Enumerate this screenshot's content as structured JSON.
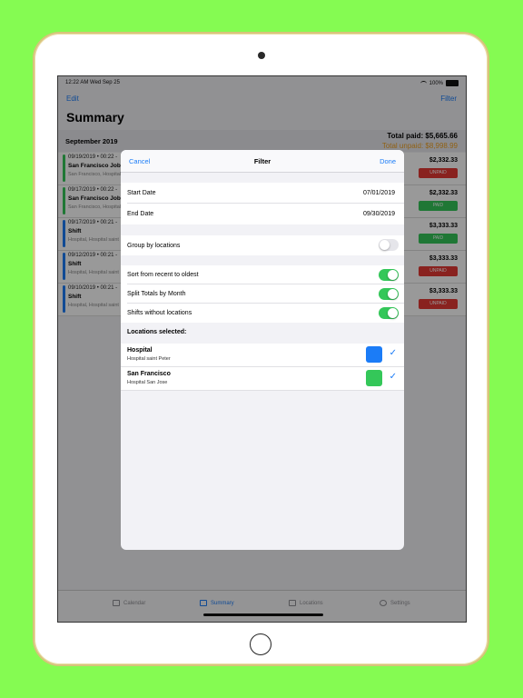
{
  "status": {
    "time": "12:22 AM  Wed Sep 25",
    "battery": "100%"
  },
  "nav": {
    "edit": "Edit",
    "filter": "Filter"
  },
  "title": "Summary",
  "section": {
    "month": "September 2019",
    "total_paid": "Total paid: $5,665.66",
    "total_unpaid": "Total unpaid: $8,998.99"
  },
  "colors": {
    "green": "#34c759",
    "blue": "#1b7cf7",
    "red": "#e53935",
    "orange": "#f0a224"
  },
  "rows": [
    {
      "date": "09/19/2019 • 00:22 -",
      "name": "San Francisco Job",
      "sub": "San Francisco, Hospital",
      "amount": "$2,332.33",
      "status": "UNPAID",
      "bar_color": "#34c759"
    },
    {
      "date": "09/17/2019 • 00:22 -",
      "name": "San Francisco Job",
      "sub": "San Francisco, Hospital",
      "amount": "$2,332.33",
      "status": "PAID",
      "bar_color": "#34c759"
    },
    {
      "date": "09/17/2019 • 00:21 -",
      "name": "Shift",
      "sub": "Hospital, Hospital saint",
      "amount": "$3,333.33",
      "status": "PAID",
      "bar_color": "#1b7cf7"
    },
    {
      "date": "09/12/2019 • 00:21 -",
      "name": "Shift",
      "sub": "Hospital, Hospital saint",
      "amount": "$3,333.33",
      "status": "UNPAID",
      "bar_color": "#1b7cf7"
    },
    {
      "date": "09/10/2019 • 00:21 -",
      "name": "Shift",
      "sub": "Hospital, Hospital saint",
      "amount": "$3,333.33",
      "status": "UNPAID",
      "bar_color": "#1b7cf7"
    }
  ],
  "tabs": [
    "Calendar",
    "Summary",
    "Locations",
    "Settings"
  ],
  "modal": {
    "cancel": "Cancel",
    "title": "Filter",
    "done": "Done",
    "start_label": "Start Date",
    "start_value": "07/01/2019",
    "end_label": "End Date",
    "end_value": "09/30/2019",
    "group_label": "Group by locations",
    "sort_label": "Sort from recent to oldest",
    "split_label": "Split Totals by Month",
    "shifts_label": "Shifts without locations",
    "locations_header": "Locations selected:",
    "locations": [
      {
        "name": "Hospital",
        "sub": "Hospital saint Peter",
        "color": "#1b7cf7"
      },
      {
        "name": "San Francisco",
        "sub": "Hospital San Jose",
        "color": "#34c759"
      }
    ]
  }
}
